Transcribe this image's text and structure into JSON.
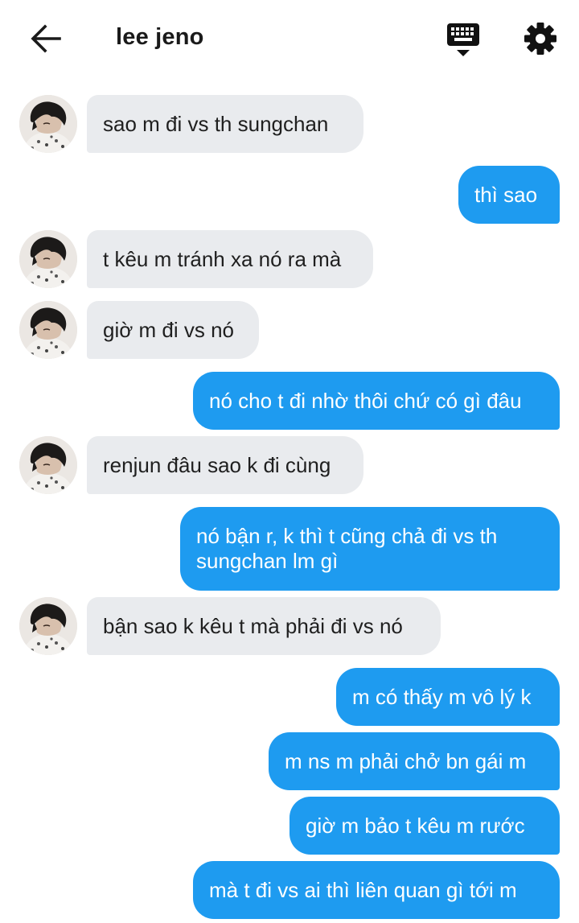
{
  "header": {
    "title": "lee jeno",
    "back_icon": "arrow-left-icon",
    "keyboard_icon": "keyboard-icon",
    "settings_icon": "gear-icon"
  },
  "colors": {
    "incoming_bubble": "#e9ebee",
    "outgoing_bubble": "#1e9bf0",
    "outgoing_text": "#ffffff"
  },
  "messages": [
    {
      "from": "them",
      "text": "sao m đi vs th sungchan"
    },
    {
      "from": "me",
      "text": "thì sao"
    },
    {
      "from": "them",
      "text": "t kêu m tránh xa nó ra mà"
    },
    {
      "from": "them",
      "text": "giờ m đi vs nó"
    },
    {
      "from": "me",
      "text": "nó cho t đi nhờ thôi chứ có gì đâu"
    },
    {
      "from": "them",
      "text": "renjun đâu sao k đi cùng"
    },
    {
      "from": "me",
      "text": "nó bận r, k thì t cũng chả đi vs th sungchan lm gì"
    },
    {
      "from": "them",
      "text": "bận sao k kêu t mà phải đi vs nó"
    },
    {
      "from": "me",
      "text": "m có thấy m vô lý k"
    },
    {
      "from": "me",
      "text": "m ns m phải chở bn gái m"
    },
    {
      "from": "me",
      "text": "giờ m bảo t kêu m rước"
    },
    {
      "from": "me",
      "text": "mà t đi vs ai thì liên quan gì tới m"
    }
  ]
}
